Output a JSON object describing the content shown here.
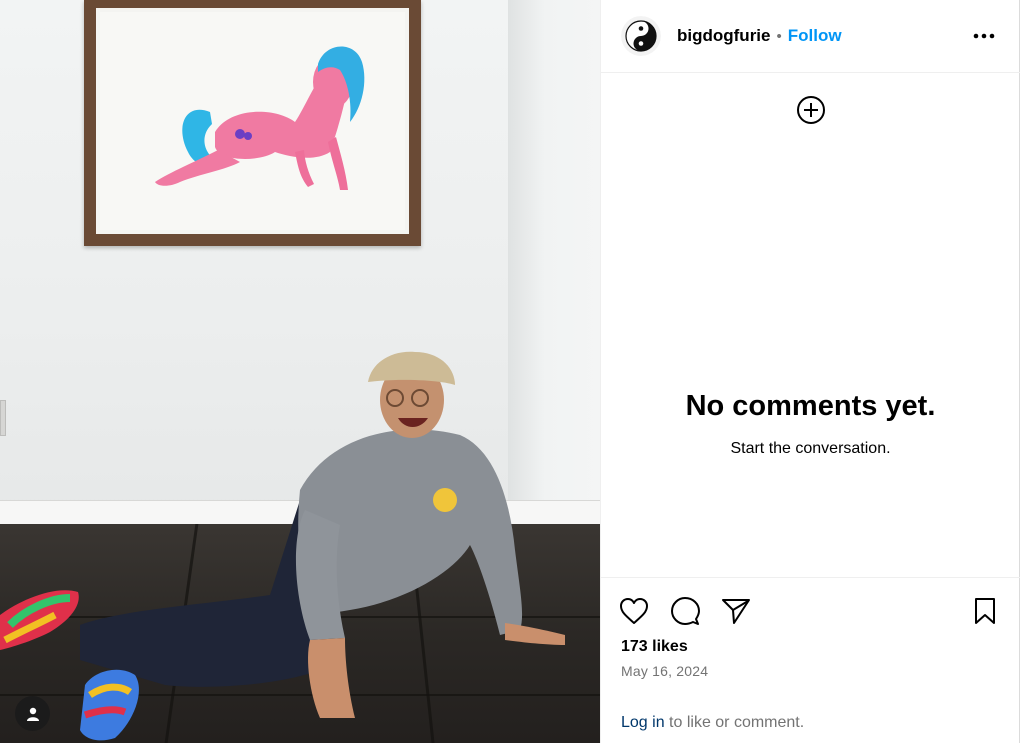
{
  "post": {
    "username": "bigdogfurie",
    "separator": "•",
    "follow_label": "Follow",
    "avatar_icon": "yin-yang-icon",
    "more_icon": "more-horizontal-icon"
  },
  "comments": {
    "add_icon": "add-circle-icon",
    "empty_title": "No comments yet.",
    "empty_subtitle": "Start the conversation."
  },
  "actions": {
    "like_icon": "heart-icon",
    "comment_icon": "comment-icon",
    "share_icon": "share-icon",
    "save_icon": "bookmark-icon",
    "likes_text": "173 likes",
    "date_text": "May 16, 2024",
    "login_link": "Log in",
    "login_rest": " to like or comment."
  },
  "media": {
    "tagged_user_icon": "user-icon"
  },
  "colors": {
    "accent": "#0095f6",
    "link": "#00376b",
    "muted": "#737373"
  }
}
